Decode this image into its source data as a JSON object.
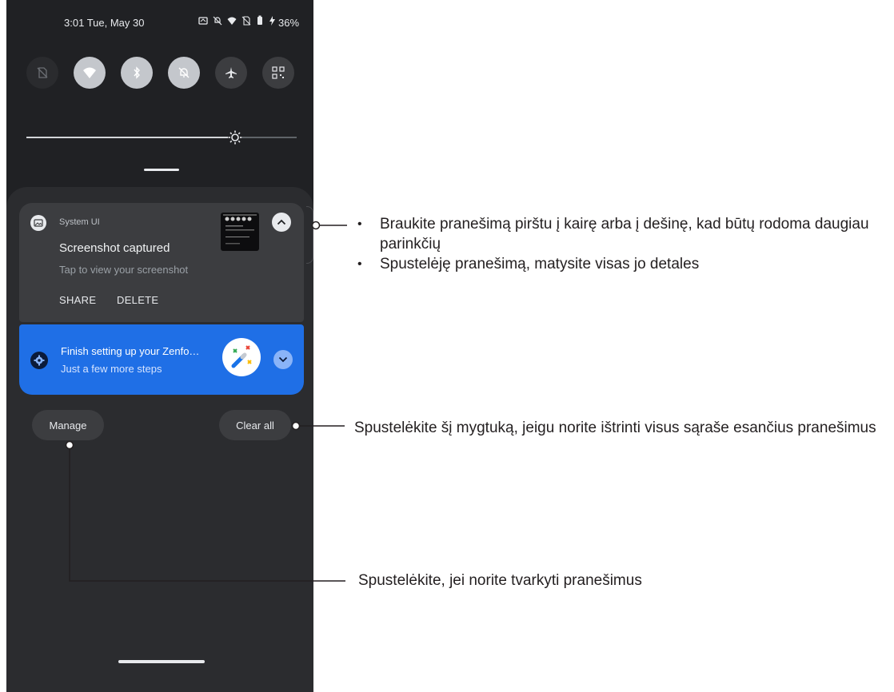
{
  "status_bar": {
    "time": "3:01",
    "date": "Tue, May 30",
    "battery": "36%"
  },
  "quick_settings": [
    {
      "name": "no-sim-icon",
      "state": "dim"
    },
    {
      "name": "wifi-icon",
      "state": "on"
    },
    {
      "name": "bluetooth-icon",
      "state": "on"
    },
    {
      "name": "do-not-disturb-icon",
      "state": "on"
    },
    {
      "name": "airplane-icon",
      "state": "off"
    },
    {
      "name": "qr-scanner-icon",
      "state": "off"
    }
  ],
  "brightness_level": 0.77,
  "notification_screenshot": {
    "app": "System UI",
    "title": "Screenshot captured",
    "subtitle": "Tap to view your screenshot",
    "action_share": "SHARE",
    "action_delete": "DELETE"
  },
  "notification_setup": {
    "title": "Finish setting up your Zenfo…",
    "subtitle": "Just a few more steps"
  },
  "buttons": {
    "manage": "Manage",
    "clear_all": "Clear all"
  },
  "callouts": {
    "swipe": "Braukite pranešimą pirštu į kairę arba į dešinę, kad būtų rodoma daugiau parinkčių",
    "tap": "Spustelėję pranešimą, matysite visas jo detales",
    "clear": "Spustelėkite šį mygtuką, jeigu norite ištrinti visus sąraše esančius pranešimus",
    "manage": "Spustelėkite, jei norite tvarkyti pranešimus"
  },
  "colors": {
    "accent_blue": "#1f6fe6",
    "panel": "#2b2c2f",
    "card": "#3c3d40"
  }
}
